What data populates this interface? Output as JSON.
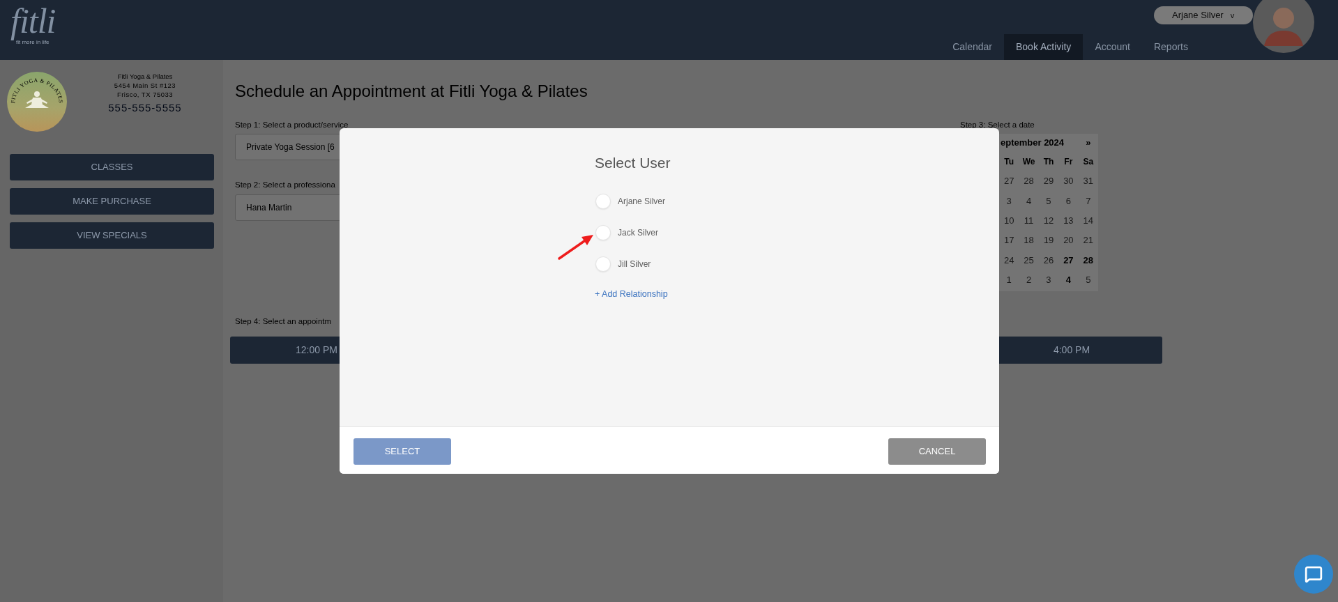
{
  "header": {
    "logo": {
      "wordmark": "fitli",
      "tagline": "fit more in life"
    },
    "user_menu": {
      "name": "Arjane Silver",
      "caret": "v"
    },
    "nav": [
      {
        "label": "Calendar",
        "selected": false
      },
      {
        "label": "Book Activity",
        "selected": true
      },
      {
        "label": "Account",
        "selected": false
      },
      {
        "label": "Reports",
        "selected": false
      }
    ]
  },
  "sidebar": {
    "studio": {
      "logo_text": "FITLI YOGA & PILATES",
      "name": "Fitli Yoga & Pilates",
      "address_line1": "5454 Main St #123",
      "address_line2": "Frisco, TX 75033",
      "phone": "555-555-5555"
    },
    "buttons": [
      "CLASSES",
      "MAKE PURCHASE",
      "VIEW SPECIALS"
    ]
  },
  "main": {
    "title": "Schedule an Appointment at Fitli Yoga & Pilates",
    "step1": {
      "label": "Step 1: Select a product/service",
      "value": "Private Yoga Session [6"
    },
    "step2": {
      "label": "Step 2: Select a professiona",
      "value": "Hana Martin"
    },
    "step3": {
      "label": "Step 3: Select a date",
      "calendar": {
        "month": "eptember 2024",
        "next": "»",
        "weekdays": [
          "Tu",
          "We",
          "Th",
          "Fr",
          "Sa"
        ],
        "weeks": [
          [
            {
              "day": "27",
              "available": false
            },
            {
              "day": "28",
              "available": false
            },
            {
              "day": "29",
              "available": false
            },
            {
              "day": "30",
              "available": false
            },
            {
              "day": "31",
              "available": false
            }
          ],
          [
            {
              "day": "3",
              "available": false
            },
            {
              "day": "4",
              "available": false
            },
            {
              "day": "5",
              "available": false
            },
            {
              "day": "6",
              "available": false
            },
            {
              "day": "7",
              "available": false
            }
          ],
          [
            {
              "day": "10",
              "available": false
            },
            {
              "day": "11",
              "available": false
            },
            {
              "day": "12",
              "available": false
            },
            {
              "day": "13",
              "available": false
            },
            {
              "day": "14",
              "available": false
            }
          ],
          [
            {
              "day": "17",
              "available": false
            },
            {
              "day": "18",
              "available": false
            },
            {
              "day": "19",
              "available": false
            },
            {
              "day": "20",
              "available": false
            },
            {
              "day": "21",
              "available": false
            }
          ],
          [
            {
              "day": "24",
              "available": false
            },
            {
              "day": "25",
              "available": false
            },
            {
              "day": "26",
              "available": false
            },
            {
              "day": "27",
              "available": true
            },
            {
              "day": "28",
              "available": true
            }
          ],
          [
            {
              "day": "1",
              "available": false
            },
            {
              "day": "2",
              "available": false
            },
            {
              "day": "3",
              "available": false
            },
            {
              "day": "4",
              "available": true
            },
            {
              "day": "5",
              "available": false
            }
          ]
        ]
      }
    },
    "step4": {
      "label": "Step 4: Select an appointm",
      "slots": [
        "12:00 PM",
        "4:00 PM"
      ]
    }
  },
  "modal": {
    "title": "Select User",
    "users": [
      {
        "name": "Arjane Silver",
        "selected": false
      },
      {
        "name": "Jack Silver",
        "selected": false
      },
      {
        "name": "Jill Silver",
        "selected": false
      }
    ],
    "add_link": "+ Add Relationship",
    "buttons": [
      {
        "label": "SELECT",
        "kind": "primary",
        "disabled": true
      },
      {
        "label": "CANCEL",
        "kind": "secondary",
        "disabled": false
      }
    ]
  }
}
